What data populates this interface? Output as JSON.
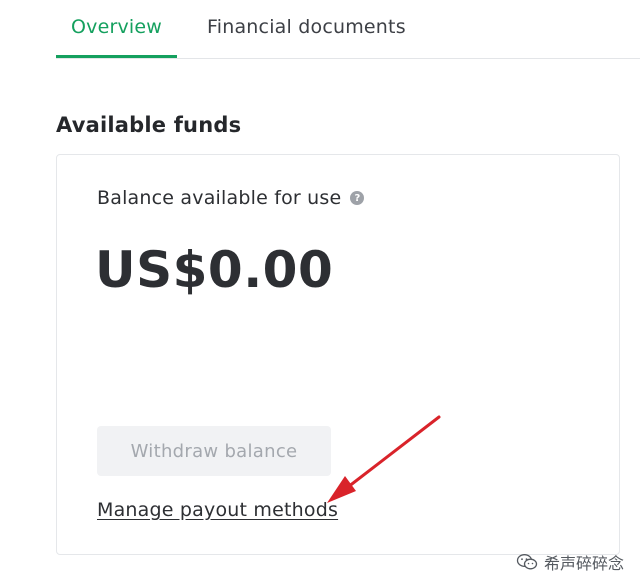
{
  "tabs": [
    {
      "label": "Overview",
      "active": true
    },
    {
      "label": "Financial documents",
      "active": false
    }
  ],
  "section": {
    "title": "Available funds"
  },
  "balance": {
    "label": "Balance available for use",
    "help_icon": "question-circle-icon",
    "amount": "US$0.00"
  },
  "actions": {
    "withdraw_label": "Withdraw balance",
    "manage_label": "Manage payout methods"
  },
  "annotation": {
    "arrow_color": "#d9232a"
  },
  "watermark": {
    "text": "希声碎碎念",
    "icon": "wechat-icon"
  },
  "colors": {
    "accent": "#14a05e",
    "disabled_bg": "#f1f2f4",
    "disabled_text": "#a4a8ae"
  }
}
